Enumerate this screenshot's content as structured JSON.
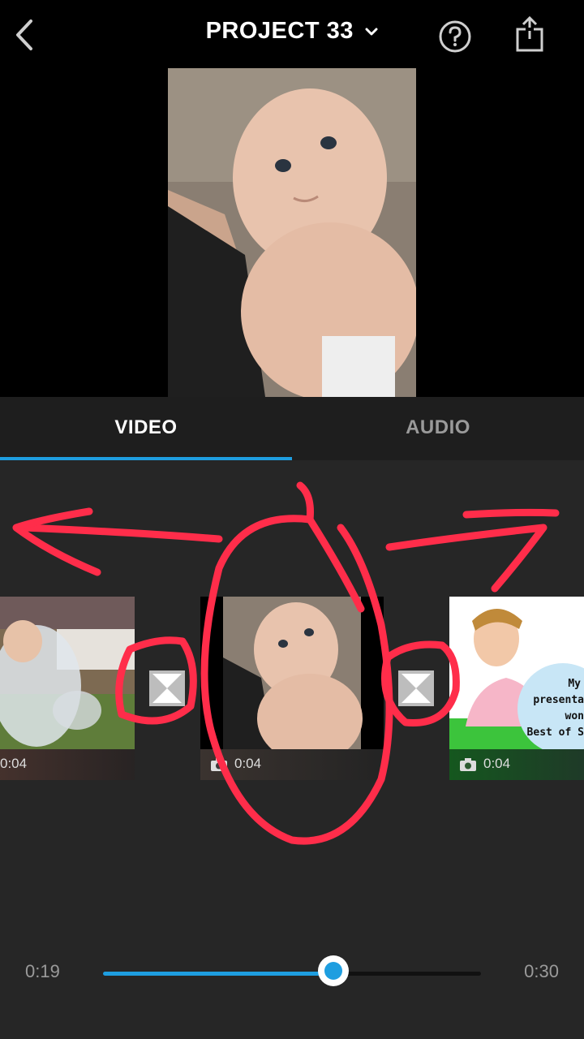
{
  "header": {
    "title": "PROJECT 33",
    "back_icon": "chevron-left-icon",
    "dropdown_icon": "chevron-down-icon",
    "help_icon": "help-circle-icon",
    "share_icon": "share-icon"
  },
  "tabs": [
    {
      "label": "VIDEO",
      "active": true
    },
    {
      "label": "AUDIO",
      "active": false
    }
  ],
  "clips": [
    {
      "duration": "0:04",
      "kind": "photo",
      "thumb": "child-with-bubble"
    },
    {
      "duration": "0:04",
      "kind": "photo",
      "thumb": "baby"
    },
    {
      "duration": "0:04",
      "kind": "photo",
      "thumb": "cartoon-avatar"
    }
  ],
  "clip3_overlay_text": [
    "My",
    "presenta",
    "won",
    "Best of S"
  ],
  "scrubber": {
    "current": "0:19",
    "total": "0:30",
    "progress": 0.61
  },
  "colors": {
    "accent": "#1e9ee0",
    "annotation": "#ff2d4a",
    "background": "#262626"
  }
}
